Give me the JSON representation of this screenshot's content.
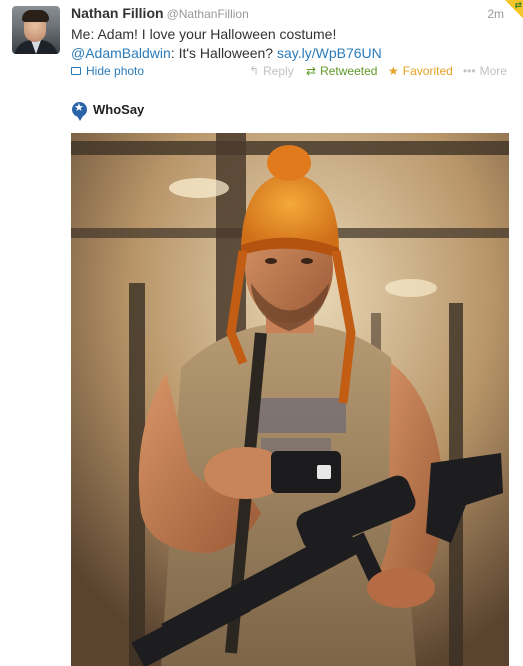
{
  "tweet": {
    "fullname": "Nathan Fillion",
    "username": "@NathanFillion",
    "timestamp": "2m",
    "text_line1": "Me: Adam! I love your Halloween costume!",
    "mention": "@AdamBaldwin",
    "text_line2_rest": ": It's Halloween? ",
    "link": "say.ly/WpB76UN"
  },
  "actions": {
    "hide_photo": "Hide photo",
    "reply": "Reply",
    "retweeted": "Retweeted",
    "favorited": "Favorited",
    "more": "More"
  },
  "source": {
    "name": "WhoSay"
  },
  "colors": {
    "link": "#2b7bb9",
    "retweeted": "#609928",
    "favorited": "#e5a122",
    "muted": "#999999"
  },
  "icons": {
    "reply": "reply-arrow-icon",
    "retweet": "retweet-icon",
    "favorite": "star-icon",
    "more": "ellipsis-icon",
    "photo": "photo-icon",
    "source": "whosay-star-icon"
  }
}
